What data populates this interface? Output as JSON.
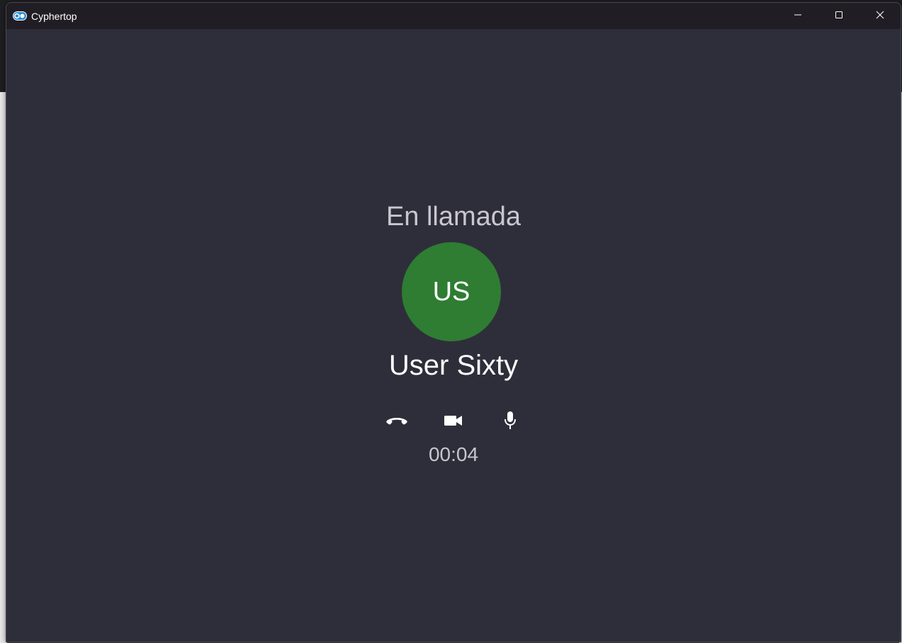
{
  "window": {
    "title": "Cyphertop",
    "controls": [
      "minimize-icon",
      "maximize-icon",
      "close-icon"
    ]
  },
  "call": {
    "status": "En llamada",
    "avatar_initials": "US",
    "avatar_color": "#2e7d32",
    "caller_name": "User Sixty",
    "timer": "00:04",
    "actions": [
      "hang-up-icon",
      "video-camera-icon",
      "microphone-icon"
    ]
  },
  "colors": {
    "background": "#2e2e3a",
    "titlebar": "#201d24",
    "status_text": "#c9c6cf",
    "name_text": "#ffffff"
  }
}
